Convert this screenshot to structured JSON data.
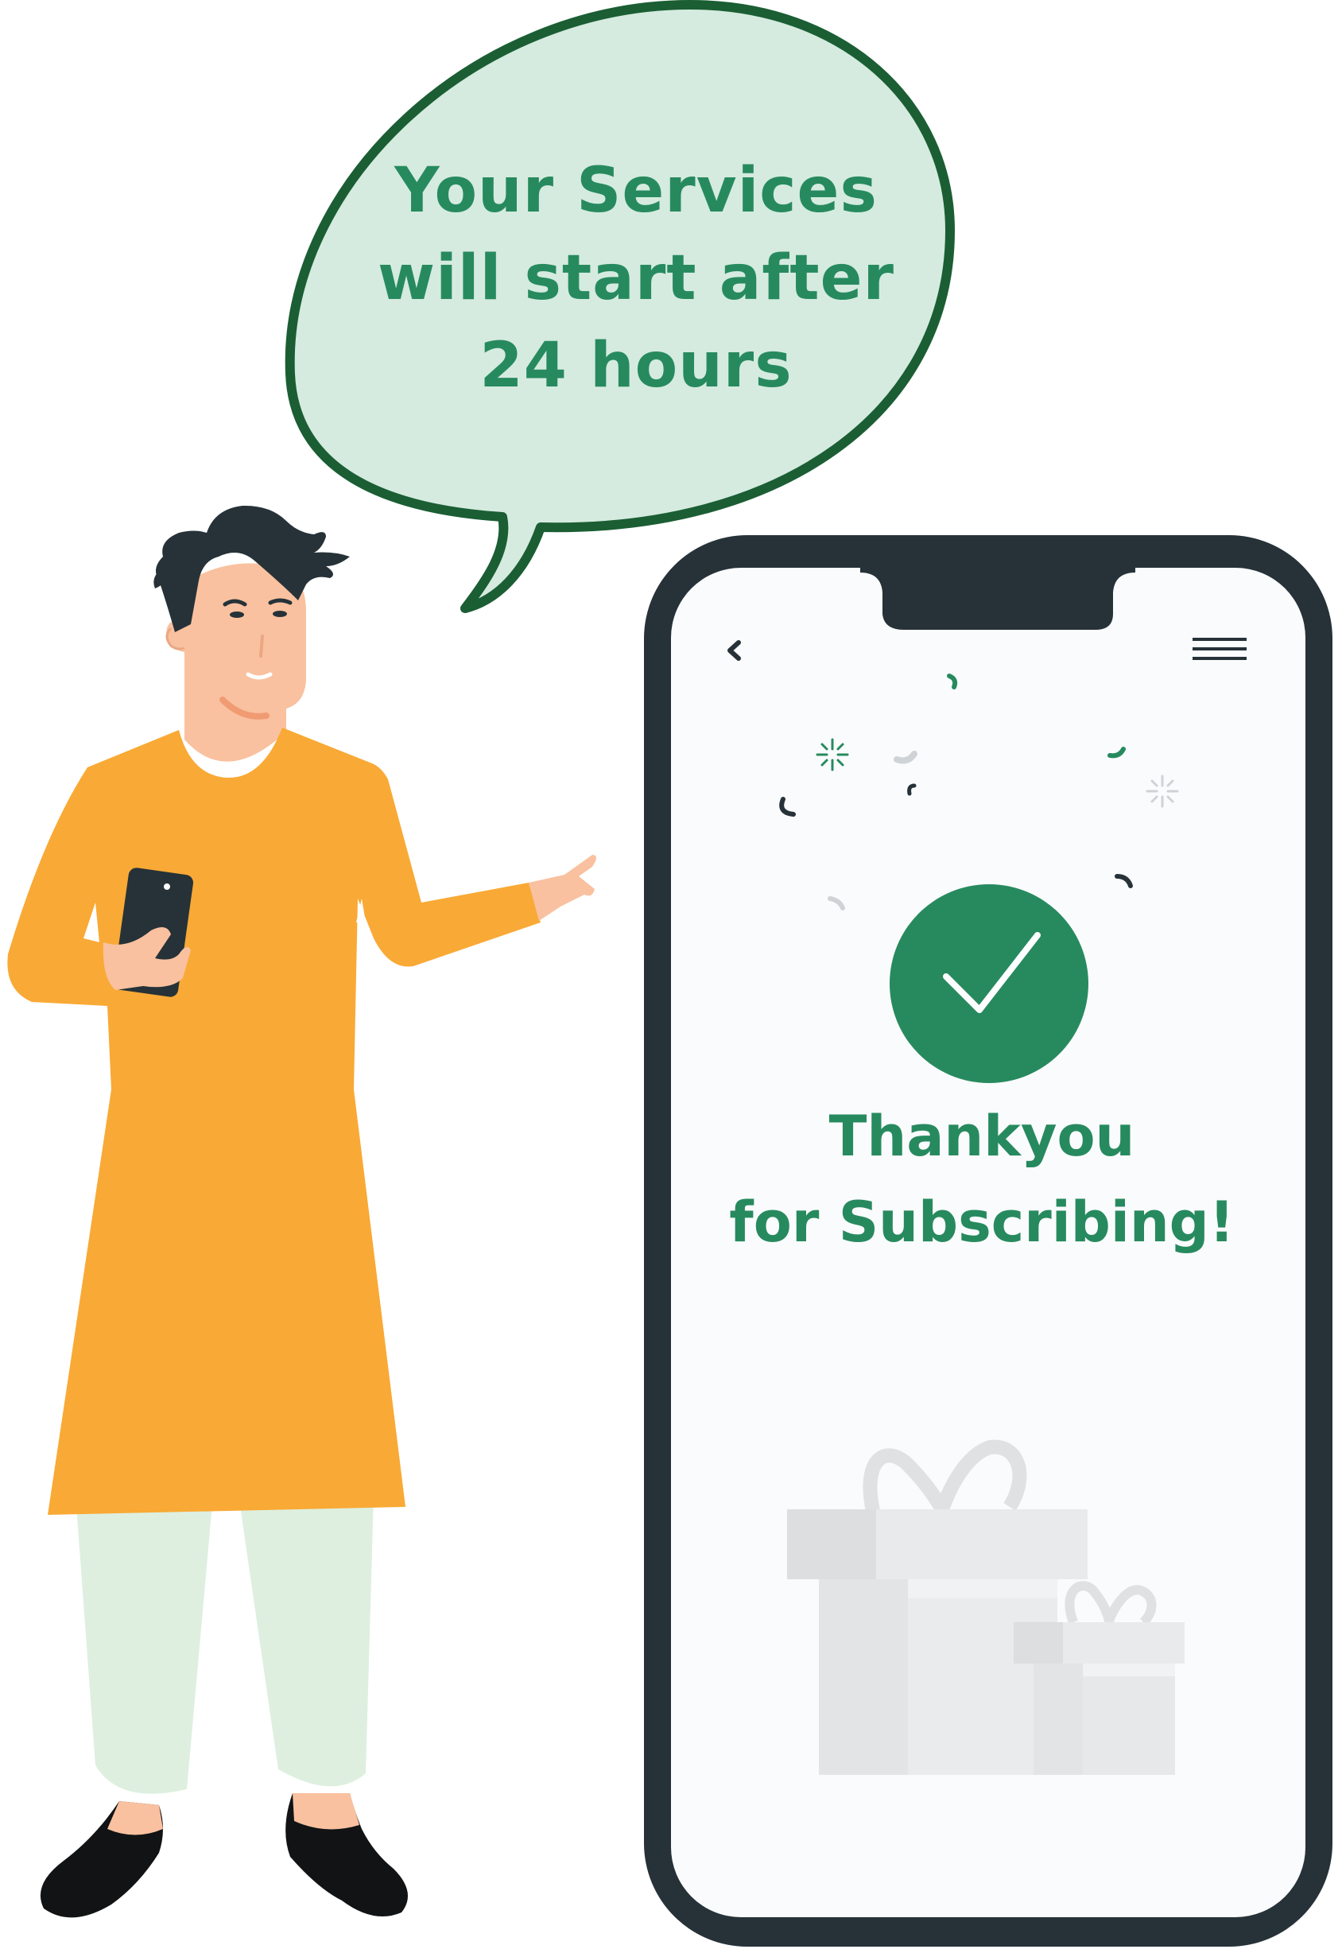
{
  "speech_bubble": {
    "lines": [
      "Your Services",
      "will start  after",
      "24 hours"
    ]
  },
  "phone_screen": {
    "back_icon": "chevron-left-icon",
    "menu_icon": "hamburger-menu-icon",
    "success_icon": "checkmark-icon",
    "message_lines": [
      "Thankyou",
      "for Subscribing!"
    ]
  },
  "colors": {
    "brand_green": "#278a5f",
    "bubble_fill": "#d5ebdf",
    "bubble_stroke": "#1b5e34",
    "phone_frame": "#263238",
    "kurta": "#f9a935",
    "pants": "#deefdf",
    "skin": "#f9c19f"
  }
}
